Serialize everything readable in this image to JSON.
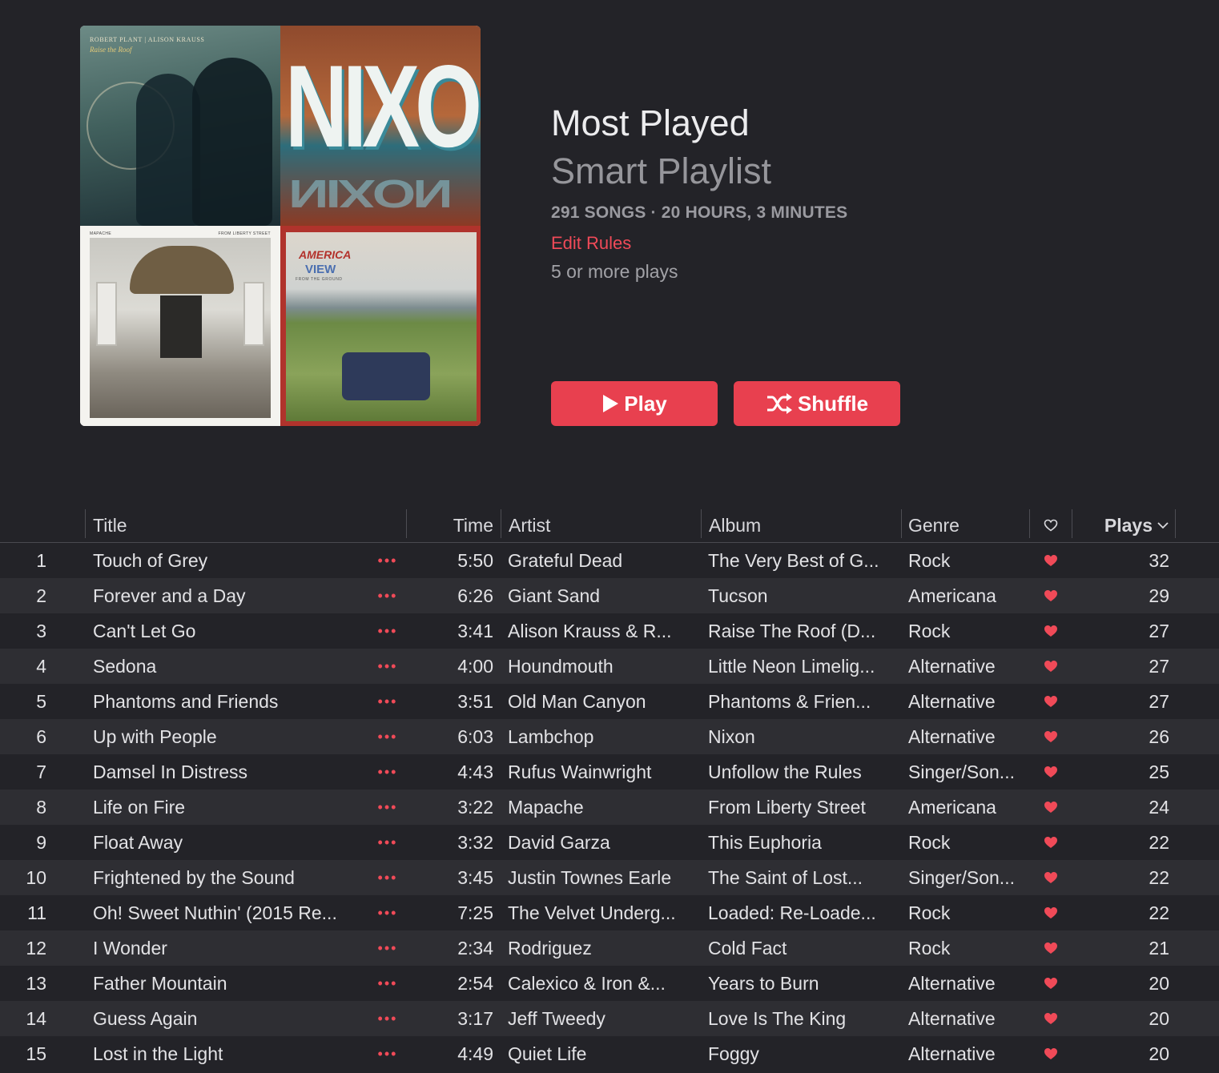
{
  "artwork": {
    "tile1": {
      "header": "ROBERT PLANT | ALISON KRAUSS",
      "subtitle": "Raise the Roof"
    },
    "tile2": {
      "word": "NIXON",
      "reflection": "NIXON"
    },
    "tile3": {
      "left_tag": "MAPACHE",
      "right_tag": "FROM LIBERTY STREET"
    },
    "tile4": {
      "logo": "AMERICA",
      "word": "VIEW",
      "tag": "FROM THE GROUND"
    }
  },
  "header": {
    "title": "Most Played",
    "subtitle": "Smart Playlist",
    "meta": "291 SONGS · 20 HOURS, 3 MINUTES",
    "edit_rules": "Edit Rules",
    "rule_description": "5 or more plays"
  },
  "buttons": {
    "play": "Play",
    "shuffle": "Shuffle"
  },
  "colors": {
    "accent": "#e8404f",
    "background": "#232328",
    "row_alt": "#2e2e33"
  },
  "table": {
    "columns": {
      "title": "Title",
      "time": "Time",
      "artist": "Artist",
      "album": "Album",
      "genre": "Genre",
      "plays": "Plays"
    },
    "rows": [
      {
        "num": "1",
        "title": "Touch of Grey",
        "time": "5:50",
        "artist": "Grateful Dead",
        "album": "The Very Best of G...",
        "genre": "Rock",
        "plays": "32"
      },
      {
        "num": "2",
        "title": "Forever and a Day",
        "time": "6:26",
        "artist": "Giant Sand",
        "album": "Tucson",
        "genre": "Americana",
        "plays": "29"
      },
      {
        "num": "3",
        "title": "Can't Let Go",
        "time": "3:41",
        "artist": "Alison Krauss & R...",
        "album": "Raise The Roof (D...",
        "genre": "Rock",
        "plays": "27"
      },
      {
        "num": "4",
        "title": "Sedona",
        "time": "4:00",
        "artist": "Houndmouth",
        "album": "Little Neon Limelig...",
        "genre": "Alternative",
        "plays": "27"
      },
      {
        "num": "5",
        "title": "Phantoms and Friends",
        "time": "3:51",
        "artist": "Old Man Canyon",
        "album": "Phantoms & Frien...",
        "genre": "Alternative",
        "plays": "27"
      },
      {
        "num": "6",
        "title": "Up with People",
        "time": "6:03",
        "artist": "Lambchop",
        "album": "Nixon",
        "genre": "Alternative",
        "plays": "26"
      },
      {
        "num": "7",
        "title": "Damsel In Distress",
        "time": "4:43",
        "artist": "Rufus Wainwright",
        "album": "Unfollow the Rules",
        "genre": "Singer/Son...",
        "plays": "25"
      },
      {
        "num": "8",
        "title": "Life on Fire",
        "time": "3:22",
        "artist": "Mapache",
        "album": "From Liberty Street",
        "genre": "Americana",
        "plays": "24"
      },
      {
        "num": "9",
        "title": "Float Away",
        "time": "3:32",
        "artist": "David Garza",
        "album": "This Euphoria",
        "genre": "Rock",
        "plays": "22"
      },
      {
        "num": "10",
        "title": "Frightened by the Sound",
        "time": "3:45",
        "artist": "Justin Townes Earle",
        "album": "The Saint of Lost...",
        "genre": "Singer/Son...",
        "plays": "22"
      },
      {
        "num": "11",
        "title": "Oh! Sweet Nuthin' (2015 Re...",
        "time": "7:25",
        "artist": "The Velvet Underg...",
        "album": "Loaded: Re-Loade...",
        "genre": "Rock",
        "plays": "22"
      },
      {
        "num": "12",
        "title": "I Wonder",
        "time": "2:34",
        "artist": "Rodriguez",
        "album": "Cold Fact",
        "genre": "Rock",
        "plays": "21"
      },
      {
        "num": "13",
        "title": "Father Mountain",
        "time": "2:54",
        "artist": "Calexico & Iron &...",
        "album": "Years to Burn",
        "genre": "Alternative",
        "plays": "20"
      },
      {
        "num": "14",
        "title": "Guess Again",
        "time": "3:17",
        "artist": "Jeff Tweedy",
        "album": "Love Is The King",
        "genre": "Alternative",
        "plays": "20"
      },
      {
        "num": "15",
        "title": "Lost in the Light",
        "time": "4:49",
        "artist": "Quiet Life",
        "album": "Foggy",
        "genre": "Alternative",
        "plays": "20"
      }
    ]
  }
}
